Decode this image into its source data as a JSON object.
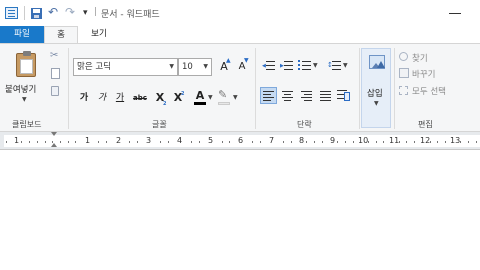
{
  "window": {
    "title": "문서 - 워드패드",
    "qat_dropdown": "▾",
    "separator": "|"
  },
  "tabs": [
    {
      "label": "파일"
    },
    {
      "label": "홈"
    },
    {
      "label": "보기"
    }
  ],
  "clipboard": {
    "paste_label": "붙여넣기",
    "group_label": "클립보드"
  },
  "font": {
    "family_value": "맑은 고딕",
    "size_value": "10",
    "grow_label": "A",
    "shrink_label": "A",
    "bold_label": "가",
    "italic_label": "가",
    "underline_label": "가",
    "strike_label": "abc",
    "subscript_label": "X",
    "superscript_label": "X",
    "color_label": "A",
    "group_label": "글꼴"
  },
  "paragraph": {
    "group_label": "단락"
  },
  "insert": {
    "label": "삽입"
  },
  "editing": {
    "find_label": "찾기",
    "replace_label": "바꾸기",
    "select_all_label": "모두 선택",
    "group_label": "편집"
  },
  "ruler": {
    "numbers": [
      "1",
      "1",
      "2",
      "3",
      "4",
      "5",
      "6",
      "7",
      "8",
      "9",
      "10",
      "11",
      "12",
      "13"
    ]
  },
  "colors": {
    "accent": "#1979ca",
    "font_color_bar": "#000000",
    "highlight_bar": "#e8e8e8"
  }
}
